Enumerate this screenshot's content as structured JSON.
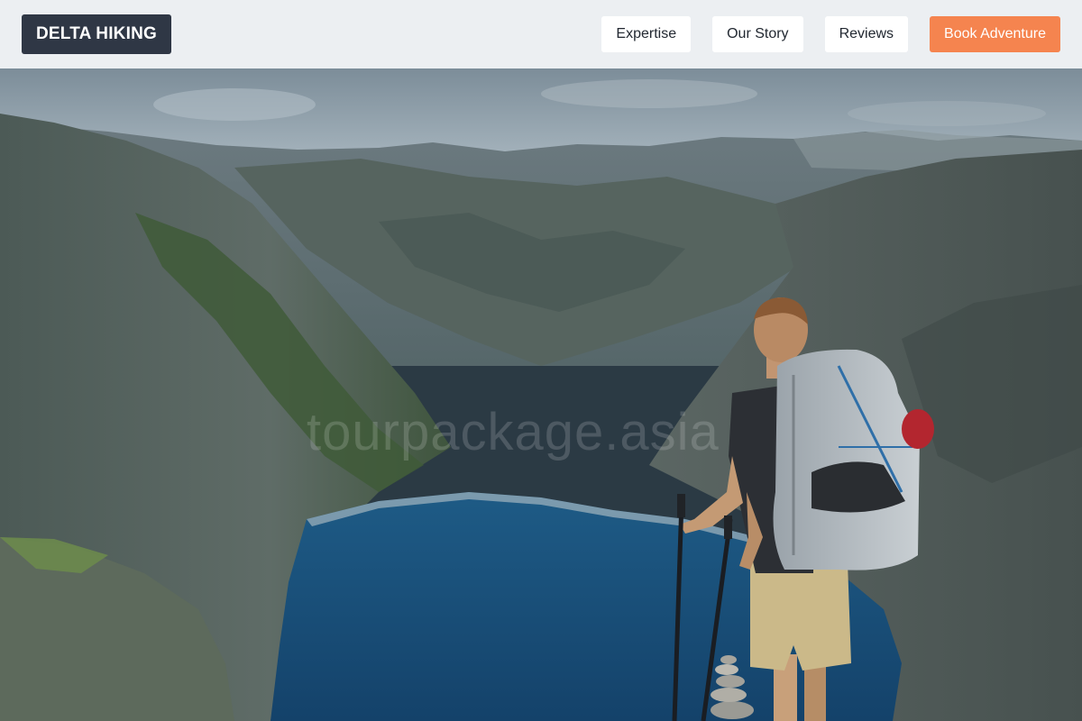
{
  "header": {
    "logo_text": "DELTA HIKING",
    "nav": [
      {
        "label": "Expertise"
      },
      {
        "label": "Our Story"
      },
      {
        "label": "Reviews"
      }
    ],
    "cta_label": "Book Adventure"
  },
  "hero": {
    "watermark_text": "tourpackage.asia"
  },
  "colors": {
    "header_bg": "#eceff2",
    "logo_bg": "#2f3745",
    "cta_bg": "#f5844f",
    "lake": "#1c4d78"
  }
}
